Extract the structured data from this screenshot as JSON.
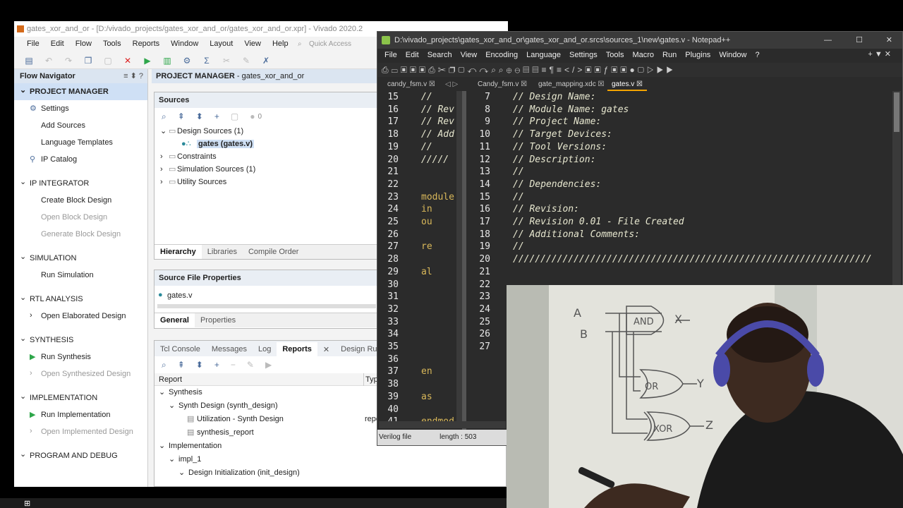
{
  "vivado": {
    "title": "gates_xor_and_or - [D:/vivado_projects/gates_xor_and_or/gates_xor_and_or.xpr] - Vivado 2020.2",
    "menu": [
      "File",
      "Edit",
      "Flow",
      "Tools",
      "Reports",
      "Window",
      "Layout",
      "View",
      "Help"
    ],
    "quick_access": "Quick Access",
    "flow_navigator": {
      "title": "Flow Navigator",
      "sections": [
        {
          "label": "PROJECT MANAGER",
          "items": [
            "Settings",
            "Add Sources",
            "Language Templates",
            "IP Catalog"
          ]
        },
        {
          "label": "IP INTEGRATOR",
          "items": [
            "Create Block Design",
            "Open Block Design",
            "Generate Block Design"
          ]
        },
        {
          "label": "SIMULATION",
          "items": [
            "Run Simulation"
          ]
        },
        {
          "label": "RTL ANALYSIS",
          "items": [
            "Open Elaborated Design"
          ]
        },
        {
          "label": "SYNTHESIS",
          "items": [
            "Run Synthesis",
            "Open Synthesized Design"
          ]
        },
        {
          "label": "IMPLEMENTATION",
          "items": [
            "Run Implementation",
            "Open Implemented Design"
          ]
        },
        {
          "label": "PROGRAM AND DEBUG",
          "items": []
        }
      ]
    },
    "pm_bar": {
      "bold": "PROJECT MANAGER",
      "rest": " - gates_xor_and_or"
    },
    "sources": {
      "title": "Sources",
      "count": "0",
      "tree": [
        "Design Sources (1)",
        "gates (gates.v)",
        "Constraints",
        "Simulation Sources (1)",
        "Utility Sources"
      ],
      "tabs": [
        "Hierarchy",
        "Libraries",
        "Compile Order"
      ]
    },
    "props": {
      "title": "Source File Properties",
      "file": "gates.v",
      "tabs": [
        "General",
        "Properties"
      ]
    },
    "bottom": {
      "tabs": [
        "Tcl Console",
        "Messages",
        "Log",
        "Reports",
        "Design Runs"
      ],
      "col_report": "Report",
      "col_type": "Type",
      "rows": [
        "Synthesis",
        "Synth Design (synth_design)",
        "Utilization - Synth Design",
        "synthesis_report",
        "Implementation",
        "impl_1",
        "Design Initialization (init_design)"
      ],
      "type_cell": "repo"
    }
  },
  "npp": {
    "title": "D:\\vivado_projects\\gates_xor_and_or\\gates_xor_and_or.srcs\\sources_1\\new\\gates.v - Notepad++",
    "menu": [
      "File",
      "Edit",
      "Search",
      "View",
      "Encoding",
      "Language",
      "Settings",
      "Tools",
      "Macro",
      "Run",
      "Plugins",
      "Window",
      "?"
    ],
    "tabs": [
      "candy_fsm.v",
      "Candy_fsm.v",
      "gate_mapping.xdc",
      "gates.v"
    ],
    "left_lines": [
      "15",
      "16",
      "17",
      "18",
      "19",
      "20",
      "21",
      "22",
      "23",
      "24",
      "25",
      "26",
      "27",
      "28",
      "29",
      "30",
      "31",
      "32",
      "33",
      "34",
      "35",
      "36",
      "37",
      "38",
      "39",
      "40",
      "41"
    ],
    "left_code": [
      "//",
      "// Rev",
      "// Rev",
      "// Add",
      "//",
      "/////",
      "",
      "",
      "module",
      "    in",
      "    ou",
      "",
      "    re",
      "",
      "    al",
      "",
      "",
      "",
      "",
      "",
      "",
      "",
      "    en",
      "",
      "    as",
      "",
      "endmod"
    ],
    "right_lines": [
      "7",
      "8",
      "9",
      "10",
      "11",
      "12",
      "13",
      "14",
      "15",
      "16",
      "17",
      "18",
      "19",
      "20",
      "21",
      "22",
      "23",
      "24",
      "25",
      "26",
      "27"
    ],
    "right_code": [
      "// Design Name:",
      "// Module Name: gates",
      "// Project Name:",
      "// Target Devices:",
      "// Tool Versions:",
      "// Description:",
      "//",
      "// Dependencies:",
      "//",
      "// Revision:",
      "// Revision 0.01 - File Created",
      "// Additional Comments:",
      "//",
      "/////////////////////////////////////////////////////////////////",
      "",
      "",
      "",
      "",
      "",
      "",
      ""
    ],
    "status_type": "Verilog file",
    "status_len": "length : 503"
  },
  "whiteboard": [
    "A",
    "B",
    "AND",
    "X",
    "OR",
    "Y",
    "XOR",
    "Z"
  ]
}
